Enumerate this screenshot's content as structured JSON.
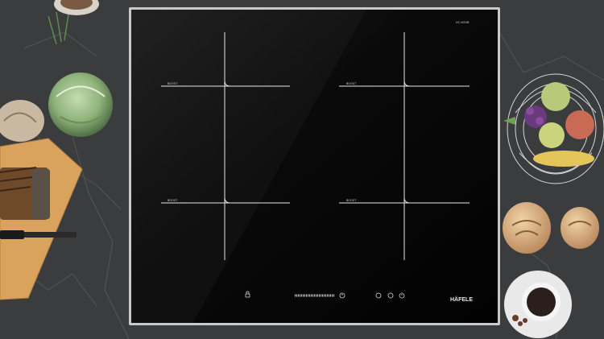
{
  "cooktop": {
    "brand": "HÄFELE",
    "model_label": "HC-I604B",
    "zone_label": "BOOST",
    "lock_icon": "lock-icon",
    "power_icon": "power-icon"
  },
  "colors": {
    "countertop": "#3b3c3e",
    "glass": "#050505",
    "frame": "#c9c9c9",
    "cutting_board": "#d9a35d",
    "cabbage": "#8fb27a"
  }
}
